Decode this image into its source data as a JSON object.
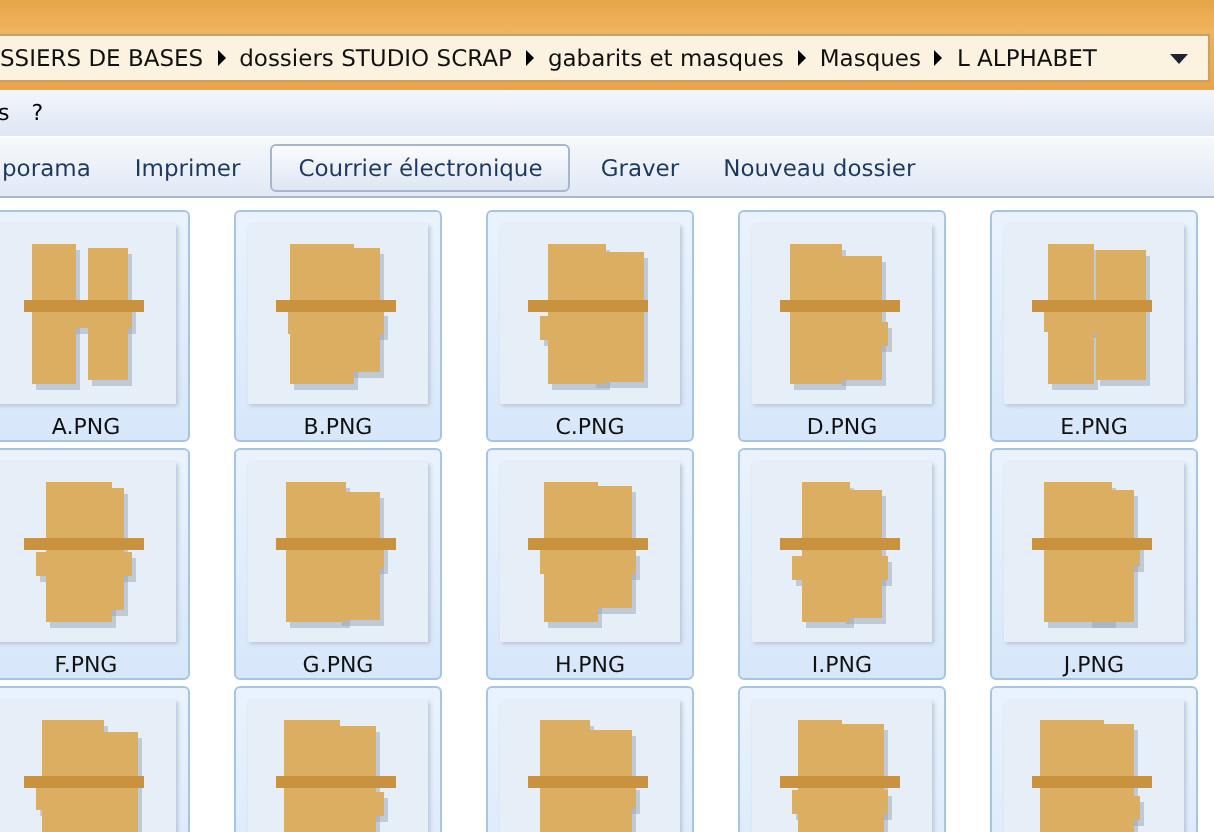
{
  "breadcrumbs": [
    "SSIERS DE BASES",
    "dossiers STUDIO SCRAP",
    "gabarits et masques",
    "Masques",
    "L ALPHABET"
  ],
  "menu": [
    "s",
    "?"
  ],
  "toolbar": [
    {
      "label": "porama",
      "selected": false
    },
    {
      "label": "Imprimer",
      "selected": false
    },
    {
      "label": "Courrier électronique",
      "selected": true
    },
    {
      "label": "Graver",
      "selected": false
    },
    {
      "label": "Nouveau dossier",
      "selected": false
    }
  ],
  "files": [
    {
      "label": "A.PNG",
      "selected": true
    },
    {
      "label": "B.PNG",
      "selected": true
    },
    {
      "label": "C.PNG",
      "selected": true
    },
    {
      "label": "D.PNG",
      "selected": true
    },
    {
      "label": "E.PNG",
      "selected": true
    },
    {
      "label": "F.PNG",
      "selected": true
    },
    {
      "label": "G.PNG",
      "selected": true
    },
    {
      "label": "H.PNG",
      "selected": true
    },
    {
      "label": "I.PNG",
      "selected": true
    },
    {
      "label": "J.PNG",
      "selected": true
    },
    {
      "selected": true
    },
    {
      "selected": true
    },
    {
      "selected": true
    },
    {
      "selected": true
    },
    {
      "selected": true
    }
  ]
}
